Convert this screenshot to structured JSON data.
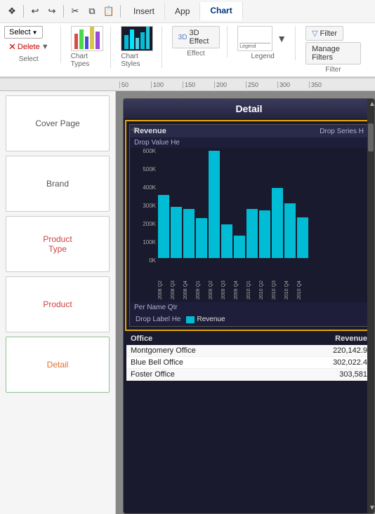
{
  "toolbar": {
    "icons": [
      "undo",
      "redo",
      "cut",
      "copy",
      "paste"
    ],
    "tabs": [
      {
        "label": "Insert",
        "active": false
      },
      {
        "label": "App",
        "active": false
      },
      {
        "label": "Chart",
        "active": true
      }
    ]
  },
  "ribbon": {
    "groups": [
      {
        "title": "Select",
        "items": [
          {
            "label": "Select",
            "type": "dropdown"
          },
          {
            "label": "Delete",
            "type": "dropdown",
            "color": "red"
          }
        ]
      },
      {
        "title": "Chart Types",
        "items": []
      },
      {
        "title": "Chart Styles",
        "items": []
      },
      {
        "title": "Effect",
        "items": [
          {
            "label": "3D Effect"
          }
        ]
      },
      {
        "title": "Legend",
        "items": []
      },
      {
        "title": "Filter",
        "items": [
          {
            "label": "Filter"
          },
          {
            "label": "Manage Filters"
          }
        ]
      }
    ]
  },
  "ruler": {
    "marks": [
      "50",
      "100",
      "150",
      "200",
      "250",
      "300",
      "350"
    ]
  },
  "left_panel": {
    "pages": [
      {
        "label": "Cover Page",
        "active": false
      },
      {
        "label": "Brand",
        "active": false
      },
      {
        "label": "Product\nType",
        "active": false,
        "highlight": true
      },
      {
        "label": "Product",
        "active": false,
        "highlight": true
      },
      {
        "label": "Detail",
        "active": true,
        "highlight": false
      }
    ]
  },
  "detail": {
    "title": "Detail",
    "chart": {
      "header_label": "Revenue",
      "header_right": "Drop Series H",
      "sub_header": "Drop Value He",
      "footer_label": "Per Name Qtr",
      "drop_label": "Drop Label He",
      "legend_label": "Revenue",
      "y_axis": [
        "600K",
        "500K",
        "400K",
        "300K",
        "200K",
        "100K",
        "0K"
      ],
      "bars": [
        {
          "height": 90,
          "label": "2008 Q2"
        },
        {
          "height": 73,
          "label": "2008 Q3"
        },
        {
          "height": 70,
          "label": "2008 Q4"
        },
        {
          "height": 57,
          "label": "2009 Q1"
        },
        {
          "height": 155,
          "label": "2009 Q2"
        },
        {
          "height": 48,
          "label": "2009 Q3"
        },
        {
          "height": 32,
          "label": "2009 Q4"
        },
        {
          "height": 70,
          "label": "2010 Q1"
        },
        {
          "height": 68,
          "label": "2010 Q2"
        },
        {
          "height": 100,
          "label": "2010 Q3"
        },
        {
          "height": 78,
          "label": "2010 Q4"
        },
        {
          "height": 58,
          "label": "2010 Q4b"
        }
      ]
    },
    "table": {
      "columns": [
        "Office",
        "Revenue"
      ],
      "rows": [
        {
          "office": "Montgomery Office",
          "revenue": "220,142.9"
        },
        {
          "office": "Blue Bell Office",
          "revenue": "302,022.4"
        },
        {
          "office": "Foster Office",
          "revenue": "303,581"
        }
      ]
    }
  }
}
